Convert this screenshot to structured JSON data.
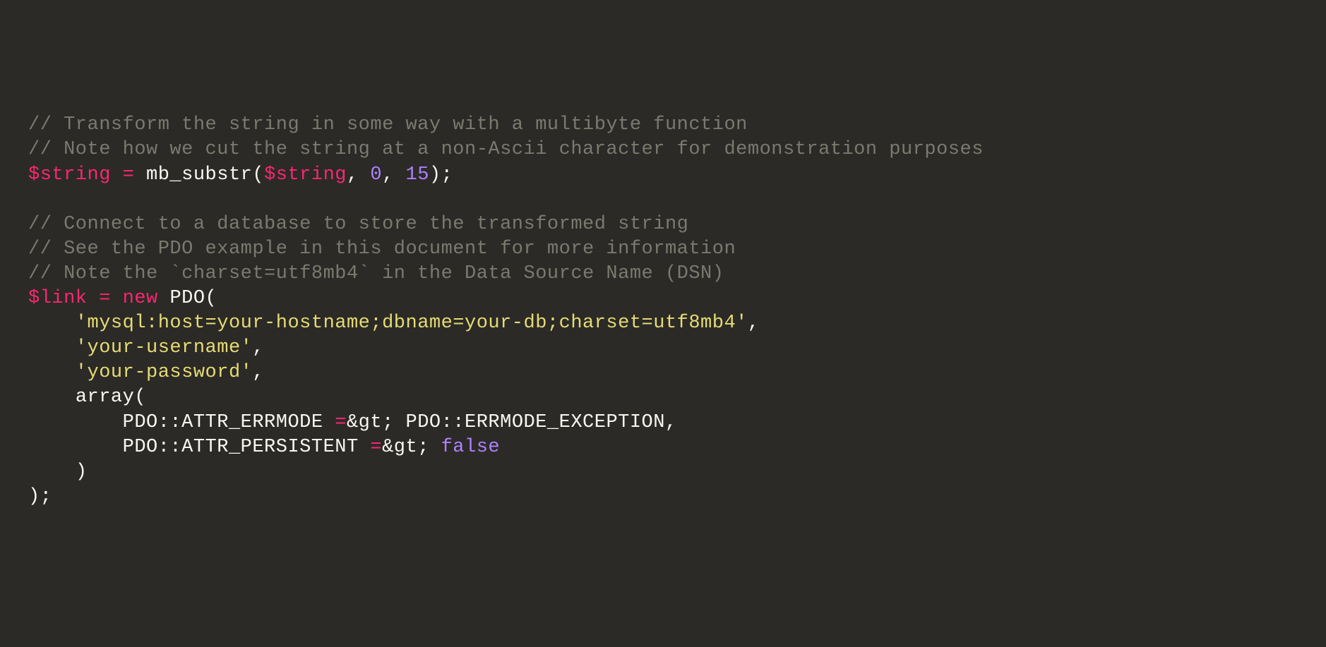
{
  "code": {
    "comment1": "// Transform the string in some way with a multibyte function",
    "comment2": "// Note how we cut the string at a non-Ascii character for demonstration purposes",
    "var_string": "$string",
    "eq1": " = ",
    "fn_mbsubstr": "mb_substr",
    "open_paren1": "(",
    "var_string2": "$string",
    "comma1": ", ",
    "num0": "0",
    "comma2": ", ",
    "num15": "15",
    "close_paren1": ");",
    "blank1": "",
    "comment3": "// Connect to a database to store the transformed string",
    "comment4": "// See the PDO example in this document for more information",
    "comment5": "// Note the `charset=utf8mb4` in the Data Source Name (DSN)",
    "var_link": "$link",
    "eq2": " = ",
    "kw_new": "new",
    "space_new": " ",
    "class_pdo": "PDO",
    "open_paren2": "(",
    "indent1": "    ",
    "str_dsn": "'mysql:host=your-hostname;dbname=your-db;charset=utf8mb4'",
    "comma3": ",",
    "indent2": "    ",
    "str_user": "'your-username'",
    "comma4": ",",
    "indent3": "    ",
    "str_pass": "'your-password'",
    "comma5": ",",
    "indent4": "    ",
    "fn_array": "array",
    "open_paren3": "(",
    "indent5": "        ",
    "const_errmode": "PDO::ATTR_ERRMODE",
    "arrow1a": " =",
    "arrow1b": "&gt; ",
    "const_excep": "PDO::ERRMODE_EXCEPTION",
    "comma6": ",",
    "indent6": "        ",
    "const_persist": "PDO::ATTR_PERSISTENT",
    "arrow2a": " =",
    "arrow2b": "&gt; ",
    "bool_false": "false",
    "indent7": "    ",
    "close_paren3": ")",
    "close_paren2": ");"
  }
}
